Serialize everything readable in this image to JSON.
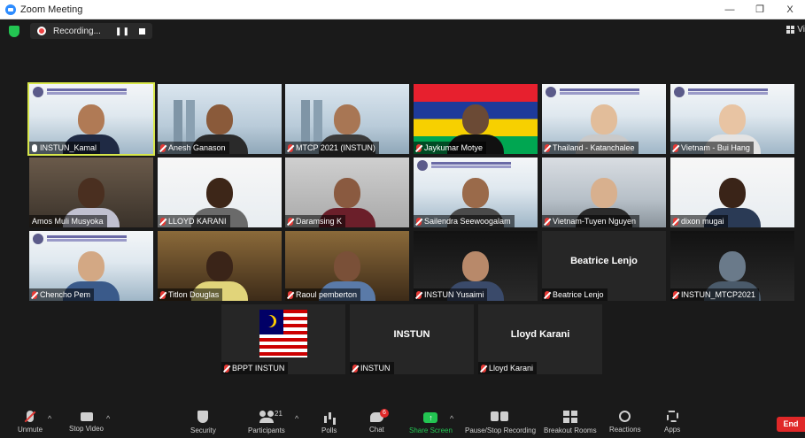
{
  "window": {
    "title": "Zoom Meeting",
    "controls": {
      "minimize": "—",
      "restore": "❐",
      "close": "X"
    }
  },
  "topbar": {
    "recording_label": "Recording...",
    "pause_label": "❚❚",
    "view_label": "Vi"
  },
  "participants": [
    {
      "name": "INSTUN_Kamal",
      "muted": false,
      "active": true,
      "bg": "bg-banner",
      "skin": "#b07a55",
      "shirt": "#1f2a44"
    },
    {
      "name": "Anesh Ganason",
      "muted": true,
      "bg": "bg-towers",
      "skin": "#8a5a3a",
      "shirt": "#2a2a2a"
    },
    {
      "name": "MTCP 2021 (INSTUN)",
      "muted": true,
      "bg": "bg-towers",
      "skin": "#a87654",
      "shirt": "#3a3a3a"
    },
    {
      "name": "Jaykumar Motye",
      "muted": true,
      "bg": "bg-mauritius",
      "skin": "#6b4a35",
      "shirt": "#111111"
    },
    {
      "name": "Thailand - Katanchalee",
      "muted": true,
      "bg": "bg-banner",
      "skin": "#e2bd9a",
      "shirt": "#c9c9c9"
    },
    {
      "name": "Vietnam - Bui Hang",
      "muted": true,
      "bg": "bg-banner",
      "skin": "#e8c4a3",
      "shirt": "#e3e3e3"
    },
    {
      "name": "Amos Muli Musyoka",
      "muted": false,
      "bg": "bg-room",
      "skin": "#4a2f20",
      "shirt": "#c0c0d0"
    },
    {
      "name": "LLOYD KARANI",
      "muted": true,
      "bg": "bg-white",
      "skin": "#3d2618",
      "shirt": "#6a6a6a"
    },
    {
      "name": "Daramsing K",
      "muted": true,
      "bg": "bg-wall",
      "skin": "#8a5a40",
      "shirt": "#6b1f2a"
    },
    {
      "name": "Sailendra Seewoogalam",
      "muted": true,
      "bg": "bg-banner",
      "skin": "#9a6a4a",
      "shirt": "#4a4a4a"
    },
    {
      "name": "Vietnam-Tuyen Nguyen",
      "muted": true,
      "bg": "bg-sky",
      "skin": "#d8b08e",
      "shirt": "#2b2b2b"
    },
    {
      "name": "dixon mugai",
      "muted": true,
      "bg": "bg-white",
      "skin": "#3a2418",
      "shirt": "#2a3a55"
    },
    {
      "name": "Chencho Pem",
      "muted": true,
      "bg": "bg-banner",
      "skin": "#d3a884",
      "shirt": "#3a5a8a"
    },
    {
      "name": "Titlon Douglas",
      "muted": true,
      "bg": "bg-warm",
      "skin": "#3a2418",
      "shirt": "#e1d47a"
    },
    {
      "name": "Raoul pemberton",
      "muted": true,
      "bg": "bg-warm",
      "skin": "#7a5038",
      "shirt": "#5a7aa8"
    },
    {
      "name": "INSTUN Yusaimi",
      "muted": true,
      "bg": "bg-dark",
      "skin": "#b8896a",
      "shirt": "#3a4a6a"
    },
    {
      "name": "Beatrice Lenjo",
      "muted": true,
      "center_label": "Beatrice Lenjo"
    },
    {
      "name": "INSTUN_MTCP2021",
      "muted": true,
      "bg": "bg-dark",
      "skin": "#6a7a8a",
      "shirt": "#4a5a6a"
    },
    {
      "name": "BPPT INSTUN",
      "muted": true,
      "flag": "malaysia"
    },
    {
      "name": "INSTUN",
      "muted": true,
      "center_label": "INSTUN"
    },
    {
      "name": "Lloyd Karani",
      "muted": true,
      "center_label": "Lloyd Karani"
    }
  ],
  "toolbar": {
    "unmute": "Unmute",
    "stop_video": "Stop Video",
    "security": "Security",
    "participants": "Participants",
    "participants_count": "21",
    "polls": "Polls",
    "chat": "Chat",
    "chat_badge": "6",
    "share_screen": "Share Screen",
    "record": "Pause/Stop Recording",
    "breakout": "Breakout Rooms",
    "reactions": "Reactions",
    "apps": "Apps",
    "end": "End",
    "caret": "^"
  },
  "colors": {
    "accent_green": "#23c552",
    "end_red": "#e02828",
    "active_speaker": "#d7e64a"
  }
}
